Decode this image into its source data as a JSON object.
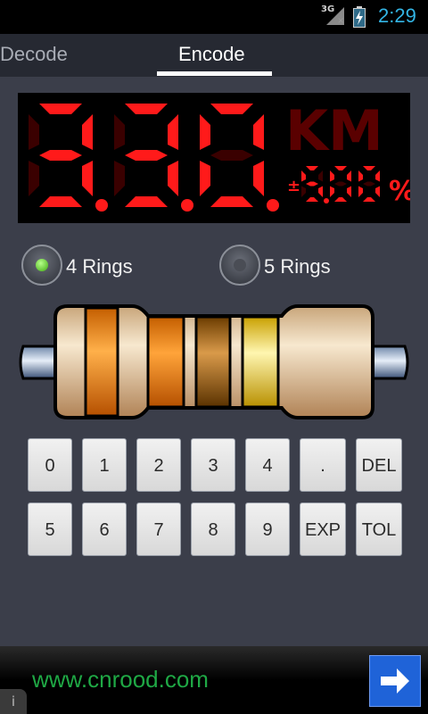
{
  "status_bar": {
    "network": "3G",
    "time": "2:29"
  },
  "tabs": [
    {
      "label": "Decode",
      "active": false
    },
    {
      "label": "Encode",
      "active": true
    }
  ],
  "display": {
    "value": "3.3.0.",
    "unit": "KM",
    "tolerance": "±5.00%",
    "colors": {
      "lit": "#ff1a1a",
      "unlit": "#3a0000"
    }
  },
  "rings_options": [
    {
      "label": "4 Rings",
      "selected": true
    },
    {
      "label": "5 Rings",
      "selected": false
    }
  ],
  "resistor": {
    "bands": [
      "orange",
      "orange",
      "brown",
      "gold"
    ],
    "band_colors": [
      "#ff8a00",
      "#ff7d00",
      "#9a5a00",
      "#ffd200"
    ]
  },
  "keypad": {
    "row1": [
      "0",
      "1",
      "2",
      "3",
      "4",
      ".",
      "DEL"
    ],
    "row2": [
      "5",
      "6",
      "7",
      "8",
      "9",
      "EXP",
      "TOL"
    ]
  },
  "ad": {
    "url": "www.cnrood.com",
    "icons": [
      "arrow-right-icon",
      "info-icon"
    ]
  }
}
